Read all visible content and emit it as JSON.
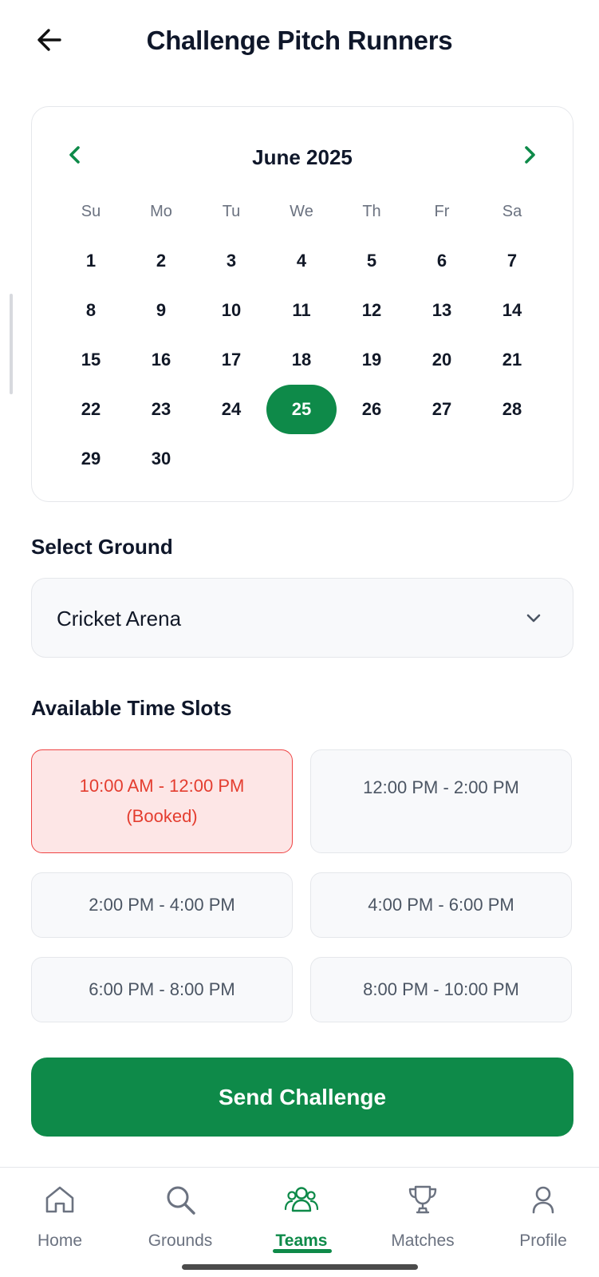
{
  "header": {
    "title": "Challenge Pitch Runners",
    "back_icon": "arrow-left-icon"
  },
  "calendar": {
    "month_label": "June 2025",
    "weekdays": [
      "Su",
      "Mo",
      "Tu",
      "We",
      "Th",
      "Fr",
      "Sa"
    ],
    "days": [
      "1",
      "2",
      "3",
      "4",
      "5",
      "6",
      "7",
      "8",
      "9",
      "10",
      "11",
      "12",
      "13",
      "14",
      "15",
      "16",
      "17",
      "18",
      "19",
      "20",
      "21",
      "22",
      "23",
      "24",
      "25",
      "26",
      "27",
      "28",
      "29",
      "30"
    ],
    "selected_day": "25",
    "accent_color": "#0e8a49"
  },
  "ground": {
    "label": "Select Ground",
    "selected": "Cricket Arena"
  },
  "time_slots": {
    "label": "Available Time Slots",
    "slots": [
      {
        "time": "10:00 AM - 12:00 PM",
        "note": "(Booked)",
        "booked": true
      },
      {
        "time": "12:00 PM - 2:00 PM",
        "note": "",
        "booked": false
      },
      {
        "time": "2:00 PM - 4:00 PM",
        "note": "",
        "booked": false
      },
      {
        "time": "4:00 PM - 6:00 PM",
        "note": "",
        "booked": false
      },
      {
        "time": "6:00 PM - 8:00 PM",
        "note": "",
        "booked": false
      },
      {
        "time": "8:00 PM - 10:00 PM",
        "note": "",
        "booked": false
      }
    ]
  },
  "actions": {
    "send_label": "Send Challenge"
  },
  "bottom_nav": {
    "items": [
      {
        "label": "Home",
        "icon": "home-icon"
      },
      {
        "label": "Grounds",
        "icon": "search-icon"
      },
      {
        "label": "Teams",
        "icon": "team-icon",
        "active": true
      },
      {
        "label": "Matches",
        "icon": "trophy-icon"
      },
      {
        "label": "Profile",
        "icon": "user-icon"
      }
    ]
  }
}
